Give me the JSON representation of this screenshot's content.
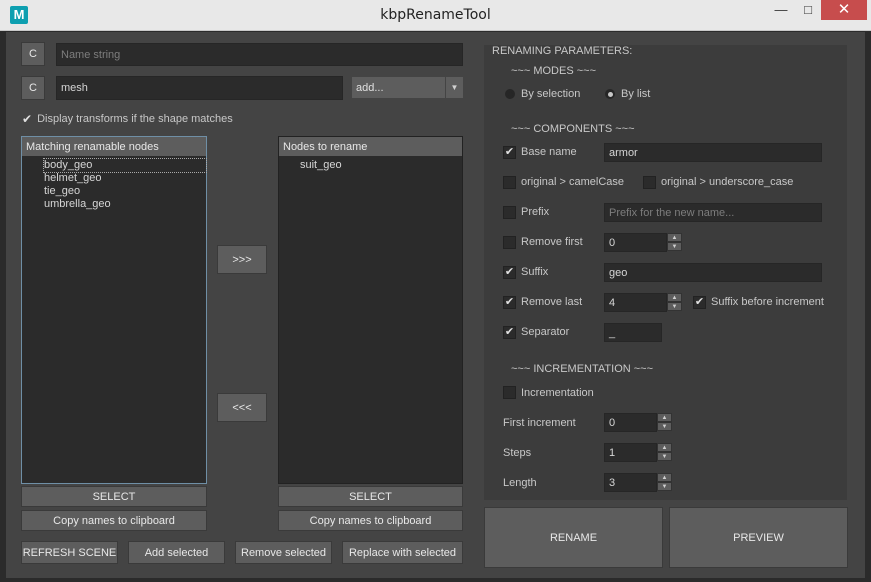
{
  "window": {
    "title": "kbpRenameTool",
    "icon_letter": "M",
    "minimize_glyph": "—",
    "maximize_glyph": "□",
    "close_glyph": "✕"
  },
  "top": {
    "clear_button_label": "C",
    "name_string_placeholder": "Name string",
    "filter_value": "mesh",
    "add_dropdown_value": "add...",
    "display_transforms_label": "Display transforms if the shape matches",
    "display_transforms_checked": true
  },
  "left_list": {
    "header": "Matching renamable nodes",
    "items": [
      "body_geo",
      "helmet_geo",
      "tie_geo",
      "umbrella_geo"
    ]
  },
  "right_list": {
    "header": "Nodes to rename",
    "items": [
      "suit_geo"
    ]
  },
  "transfer": {
    "add_label": ">>>",
    "remove_label": "<<<"
  },
  "list_buttons": {
    "select_label": "SELECT",
    "copy_label": "Copy names to clipboard"
  },
  "bottom_buttons": {
    "refresh": "REFRESH SCENE",
    "add_selected": "Add selected",
    "remove_selected": "Remove selected",
    "replace_selected": "Replace with selected"
  },
  "params": {
    "title": "RENAMING PARAMETERS:",
    "modes_header": "~~~   MODES   ~~~",
    "mode_selection": "By selection",
    "mode_list": "By list",
    "mode_active": "list",
    "components_header": "~~~   COMPONENTS   ~~~",
    "base_name_label": "Base name",
    "base_name_checked": true,
    "base_name_value": "armor",
    "camel_label": "original > camelCase",
    "camel_checked": false,
    "underscore_label": "original > underscore_case",
    "underscore_checked": false,
    "prefix_label": "Prefix",
    "prefix_checked": false,
    "prefix_placeholder": "Prefix for the new name...",
    "remove_first_label": "Remove first",
    "remove_first_checked": false,
    "remove_first_value": "0",
    "suffix_label": "Suffix",
    "suffix_checked": true,
    "suffix_value": "geo",
    "remove_last_label": "Remove last",
    "remove_last_checked": true,
    "remove_last_value": "4",
    "suffix_before_inc_label": "Suffix before increment",
    "suffix_before_inc_checked": true,
    "separator_label": "Separator",
    "separator_checked": true,
    "separator_value": "_",
    "incrementation_header": "~~~   INCREMENTATION   ~~~",
    "incrementation_label": "Incrementation",
    "incrementation_checked": false,
    "first_increment_label": "First increment",
    "first_increment_value": "0",
    "steps_label": "Steps",
    "steps_value": "1",
    "length_label": "Length",
    "length_value": "3"
  },
  "actions": {
    "rename": "RENAME",
    "preview": "PREVIEW"
  },
  "check_glyph": "✔",
  "spin_up_glyph": "▲",
  "spin_down_glyph": "▼",
  "dropdown_glyph": "▼"
}
